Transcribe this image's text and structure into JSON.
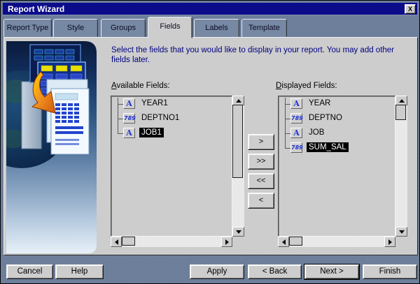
{
  "window": {
    "title": "Report Wizard",
    "close_icon": "X"
  },
  "tabs": [
    {
      "label": "Report Type",
      "active": false
    },
    {
      "label": "Style",
      "active": false
    },
    {
      "label": "Groups",
      "active": false
    },
    {
      "label": "Fields",
      "active": true
    },
    {
      "label": "Labels",
      "active": false
    },
    {
      "label": "Template",
      "active": false
    }
  ],
  "instruction": "Select the fields that you would like to display in your report. You may add other fields later.",
  "available_fields": {
    "label": "Available Fields:",
    "items": [
      {
        "label": "YEAR1",
        "type": "character",
        "icon": "A",
        "selected": false
      },
      {
        "label": "DEPTNO1",
        "type": "numeric",
        "icon": "789",
        "selected": false
      },
      {
        "label": "JOB1",
        "type": "character",
        "icon": "A",
        "selected": true
      }
    ]
  },
  "displayed_fields": {
    "label": "Displayed Fields:",
    "items": [
      {
        "label": "YEAR",
        "type": "character",
        "icon": "A",
        "selected": false
      },
      {
        "label": "DEPTNO",
        "type": "numeric",
        "icon": "789",
        "selected": false
      },
      {
        "label": "JOB",
        "type": "character",
        "icon": "A",
        "selected": false
      },
      {
        "label": "SUM_SAL",
        "type": "numeric",
        "icon": "789",
        "selected": true
      }
    ]
  },
  "transfer_buttons": [
    {
      "label": ">"
    },
    {
      "label": ">>"
    },
    {
      "label": "<<"
    },
    {
      "label": "<"
    }
  ],
  "action_buttons": {
    "cancel": "Cancel",
    "help": "Help",
    "apply": "Apply",
    "back": "< Back",
    "next": "Next >",
    "finish": "Finish"
  },
  "colors": {
    "title_bar": "#000084",
    "title_text": "#ffffff",
    "dialog_background": "#6e81a0",
    "page_background": "#cdcdcd",
    "instruction_text": "#000080",
    "selection_background": "#000000",
    "selection_text": "#ffffff",
    "field_icon_blue": "#2233cc"
  }
}
